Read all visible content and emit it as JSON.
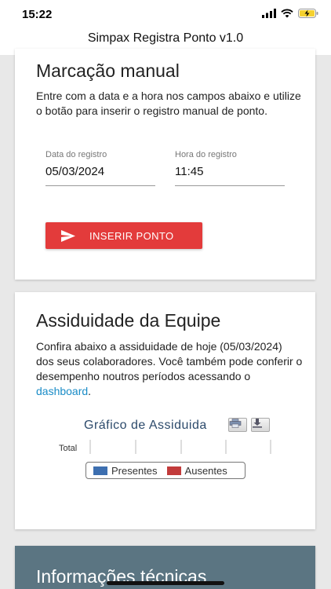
{
  "status": {
    "time": "15:22"
  },
  "app": {
    "title": "Simpax Registra Ponto v1.0"
  },
  "manual": {
    "title": "Marcação manual",
    "description": "Entre com a data e a hora nos campos abaixo e utilize o botão para inserir o registro manual de ponto.",
    "date_label": "Data do registro",
    "date_value": "05/03/2024",
    "time_label": "Hora do registro",
    "time_value": "11:45",
    "button_label": "INSERIR PONTO",
    "button_icon": "send-icon",
    "button_color": "#e33b3b"
  },
  "attendance": {
    "title": "Assiduidade da Equipe",
    "text_before_link": "Confira abaixo a assiduidade de hoje (05/03/2024) dos seus colaboradores. Você também pode conferir o desempenho noutros períodos acessando o ",
    "link_text": "dashboard",
    "text_after_link": "."
  },
  "chart_data": {
    "type": "bar",
    "title": "Gráfico de Assiduida",
    "categories": [
      "Total"
    ],
    "series": [
      {
        "name": "Presentes",
        "color": "#3d6fb0",
        "values": [
          0
        ]
      },
      {
        "name": "Ausentes",
        "color": "#c23b3b",
        "values": [
          0
        ]
      }
    ],
    "legend_position": "bottom",
    "grid": true
  },
  "info": {
    "title": "Informações técnicas"
  }
}
